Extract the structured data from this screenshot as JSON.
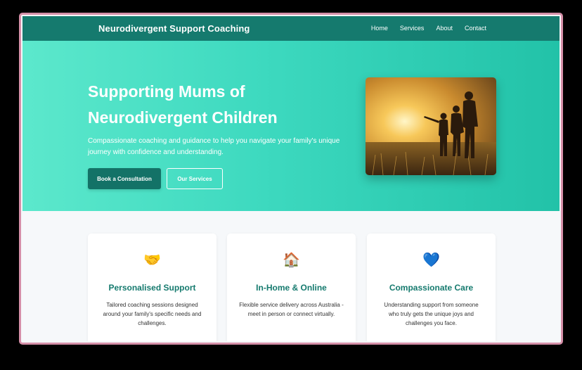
{
  "nav": {
    "brand": "Neurodivergent Support Coaching",
    "links": [
      "Home",
      "Services",
      "About",
      "Contact"
    ]
  },
  "hero": {
    "title": "Supporting Mums of Neurodivergent Children",
    "subtitle": "Compassionate coaching and guidance to help you navigate your family's unique journey with confidence and understanding.",
    "primary_button": "Book a Consultation",
    "secondary_button": "Our Services"
  },
  "cards": [
    {
      "icon": "handshake-icon",
      "glyph": "🤝",
      "title": "Personalised Support",
      "desc": "Tailored coaching sessions designed around your family's specific needs and challenges."
    },
    {
      "icon": "house-icon",
      "glyph": "🏠",
      "title": "In-Home & Online",
      "desc": "Flexible service delivery across Australia - meet in person or connect virtually."
    },
    {
      "icon": "blue-heart-icon",
      "glyph": "💙",
      "title": "Compassionate Care",
      "desc": "Understanding support from someone who truly gets the unique joys and challenges you face."
    }
  ],
  "colors": {
    "nav_bg": "#157a6e",
    "accent": "#157a6e",
    "hero_start": "#5ce8cc",
    "hero_end": "#22c2a8",
    "frame": "#d58fa8"
  }
}
